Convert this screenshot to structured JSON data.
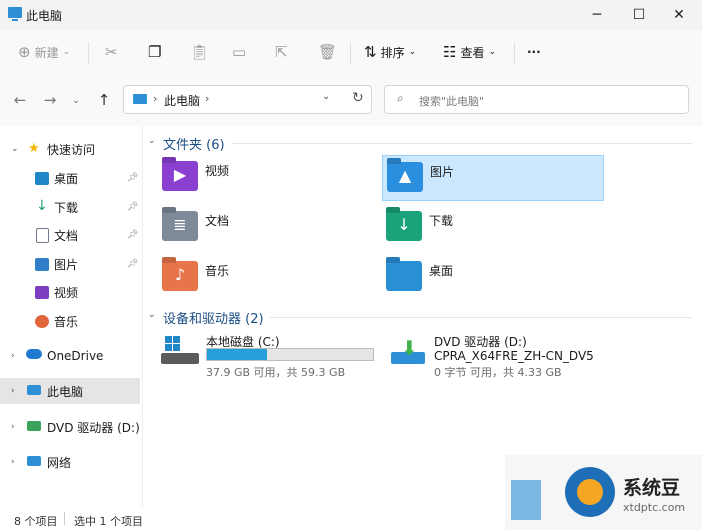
{
  "window": {
    "title": "此电脑"
  },
  "toolbar": {
    "new_label": "新建",
    "sort_label": "排序",
    "view_label": "查看",
    "more_label": "···"
  },
  "address": {
    "segments": [
      "此电脑"
    ]
  },
  "search": {
    "placeholder": "搜索\"此电脑\""
  },
  "sidebar": {
    "quick_access": "快速访问",
    "pinned": [
      {
        "label": "桌面",
        "icon": "desktop-folder-icon",
        "color": "#1f86c8"
      },
      {
        "label": "下载",
        "icon": "download-arrow-icon",
        "color": "#1f9d6a"
      },
      {
        "label": "文档",
        "icon": "document-icon",
        "color": "#6d7b8a"
      },
      {
        "label": "图片",
        "icon": "picture-icon",
        "color": "#2f7fc9"
      },
      {
        "label": "视频",
        "icon": "video-icon",
        "color": "#7b3fbf"
      },
      {
        "label": "音乐",
        "icon": "music-icon",
        "color": "#e0653d"
      }
    ],
    "onedrive": "OneDrive",
    "this_pc": "此电脑",
    "dvd": "DVD 驱动器 (D:) CF",
    "network": "网络"
  },
  "folders": {
    "title": "文件夹 (6)",
    "items": [
      {
        "label": "视频",
        "icon": "video-folder-icon",
        "color": "#8a3fd0",
        "glyph": "▶"
      },
      {
        "label": "图片",
        "icon": "pictures-folder-icon",
        "color": "#2b8fe0",
        "glyph": "▲"
      },
      {
        "label": "文档",
        "icon": "documents-folder-icon",
        "color": "#7e8a98",
        "glyph": "≣"
      },
      {
        "label": "下载",
        "icon": "downloads-folder-icon",
        "color": "#1aa37a",
        "glyph": "↓"
      },
      {
        "label": "音乐",
        "icon": "music-folder-icon",
        "color": "#e8754a",
        "glyph": "♪"
      },
      {
        "label": "桌面",
        "icon": "desktop-folder-icon",
        "color": "#2a90d6",
        "glyph": ""
      }
    ]
  },
  "devices": {
    "title": "设备和驱动器 (2)",
    "local_disk": {
      "name": "本地磁盘 (C:)",
      "space": "37.9 GB 可用，共 59.3 GB",
      "used_fraction": 0.36
    },
    "dvd": {
      "name": "DVD 驱动器 (D:)",
      "volume": "CPRA_X64FRE_ZH-CN_DV5",
      "space": "0 字节 可用，共 4.33 GB"
    }
  },
  "status": {
    "item_count": "8 个项目",
    "selected": "选中 1 个项目"
  },
  "watermark": {
    "brand": "系统豆",
    "url": "xtdptc.com"
  }
}
